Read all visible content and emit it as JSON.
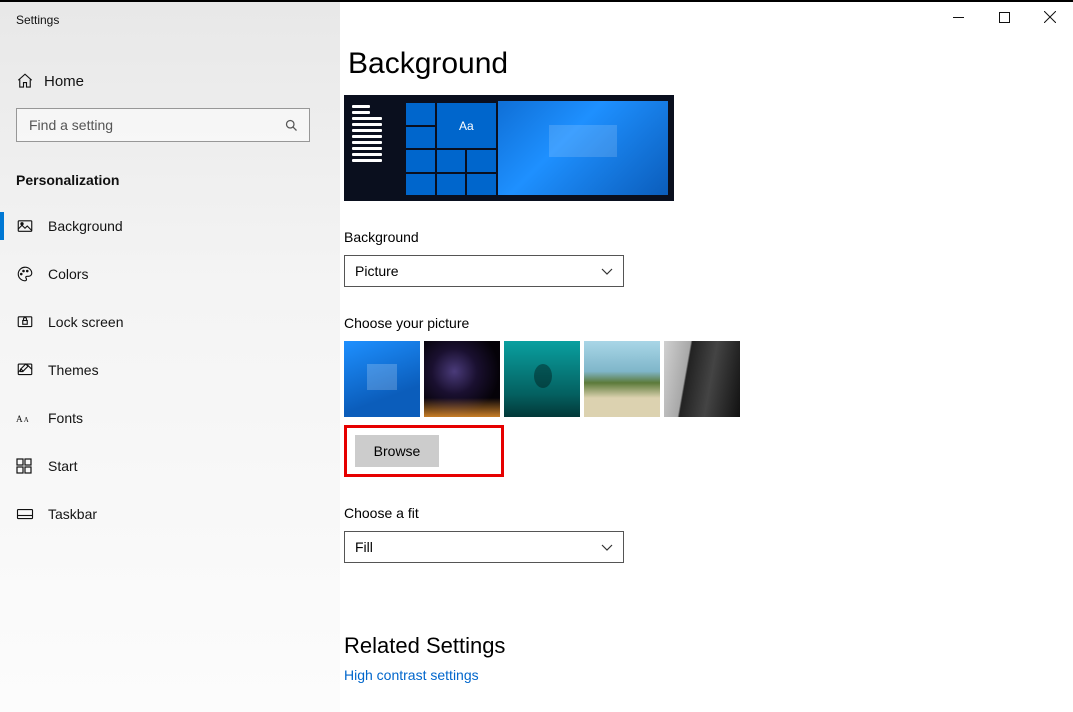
{
  "app_title": "Settings",
  "home_label": "Home",
  "search": {
    "placeholder": "Find a setting"
  },
  "category": "Personalization",
  "sidebar": {
    "items": [
      {
        "label": "Background",
        "icon": "picture-icon",
        "selected": true
      },
      {
        "label": "Colors",
        "icon": "palette-icon"
      },
      {
        "label": "Lock screen",
        "icon": "lock-screen-icon"
      },
      {
        "label": "Themes",
        "icon": "themes-icon"
      },
      {
        "label": "Fonts",
        "icon": "fonts-icon"
      },
      {
        "label": "Start",
        "icon": "start-icon"
      },
      {
        "label": "Taskbar",
        "icon": "taskbar-icon"
      }
    ]
  },
  "page": {
    "title": "Background",
    "preview_tile_text": "Aa",
    "background_label": "Background",
    "background_value": "Picture",
    "choose_picture_label": "Choose your picture",
    "browse_label": "Browse",
    "fit_label": "Choose a fit",
    "fit_value": "Fill",
    "related_heading": "Related Settings",
    "related_link": "High contrast settings"
  },
  "colors": {
    "accent": "#0078d4",
    "link": "#0066cc",
    "highlight_border": "#e60000"
  }
}
